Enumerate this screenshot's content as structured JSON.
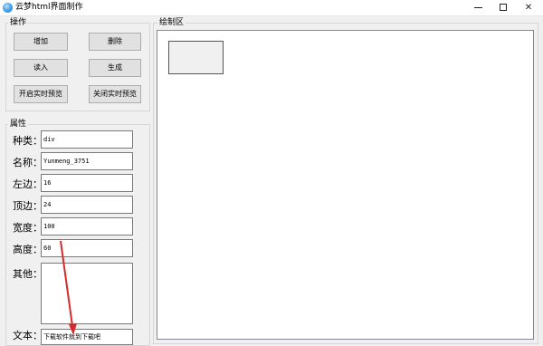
{
  "window": {
    "title": "云梦html界面制作"
  },
  "operations": {
    "group_label": "操作",
    "add_label": "增加",
    "delete_label": "删除",
    "read_label": "读入",
    "generate_label": "生成",
    "open_preview_label": "开启实时预览",
    "close_preview_label": "关闭实时预览"
  },
  "properties": {
    "group_label": "属性",
    "type_label": "种类：",
    "type_value": "div",
    "name_label": "名称：",
    "name_value": "Yunmeng_3751",
    "left_label": "左边：",
    "left_value": "16",
    "top_label": "顶边：",
    "top_value": "24",
    "width_label": "宽度：",
    "width_value": "100",
    "height_label": "高度：",
    "height_value": "60",
    "other_label": "其他：",
    "other_value": "",
    "text_label": "文本：",
    "text_value": "下载软件就到下载吧"
  },
  "canvas": {
    "group_label": "绘制区"
  },
  "colors": {
    "arrow": "#d62a2a"
  }
}
